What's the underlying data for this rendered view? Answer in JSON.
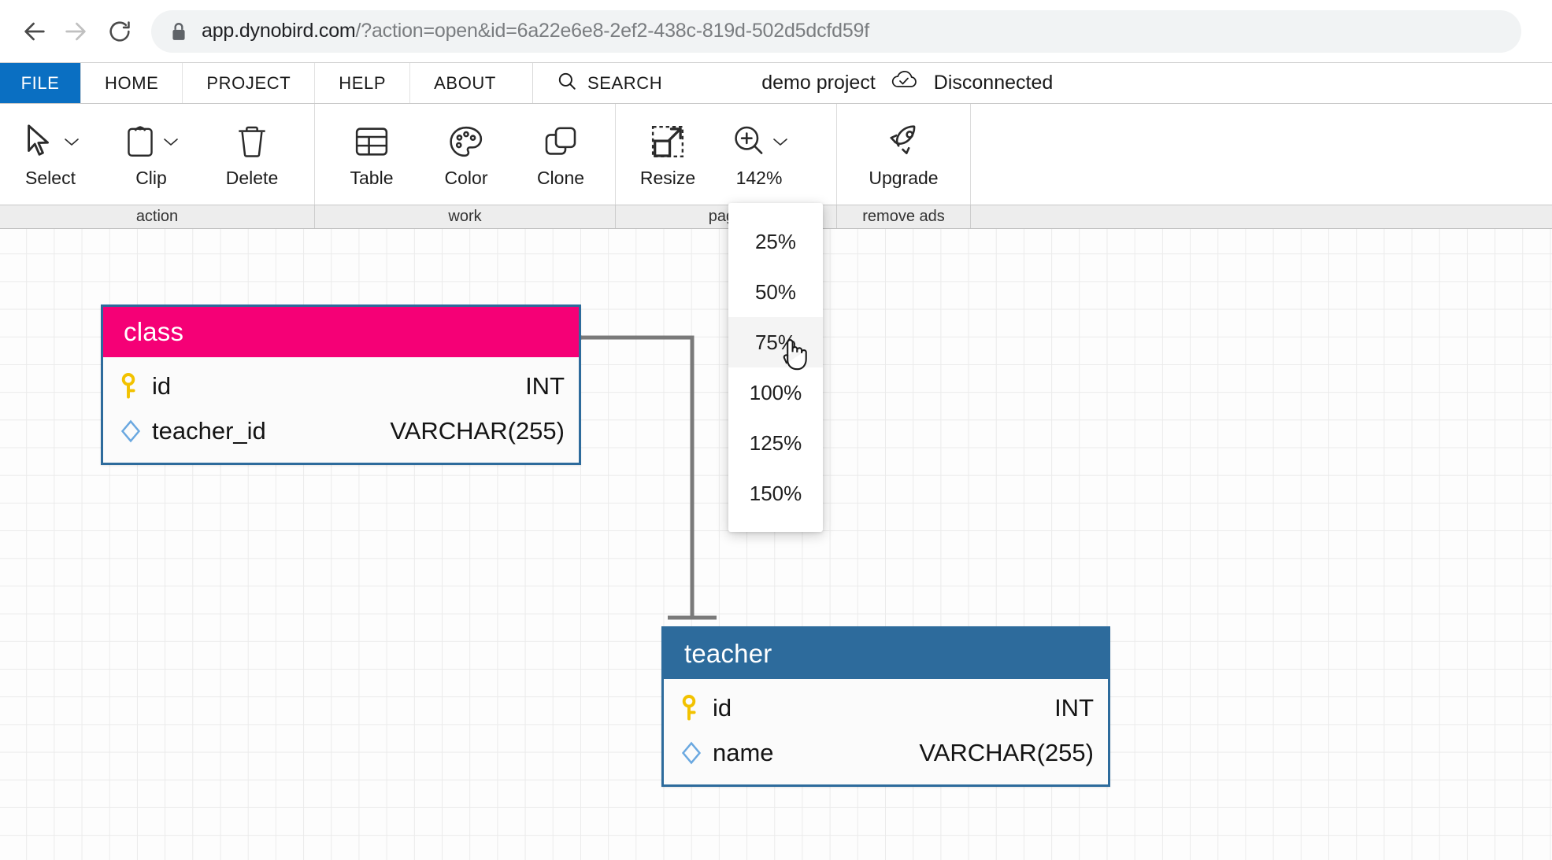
{
  "browser": {
    "back_icon": "arrow-left-icon",
    "forward_icon": "arrow-right-icon",
    "reload_icon": "reload-icon",
    "lock_icon": "lock-icon",
    "url_host": "app.dynobird.com",
    "url_path": "/?action=open&id=6a22e6e8-2ef2-438c-819d-502d5dcfd59f"
  },
  "menubar": {
    "file": "FILE",
    "items": [
      {
        "label": "HOME"
      },
      {
        "label": "PROJECT"
      },
      {
        "label": "HELP"
      },
      {
        "label": "ABOUT"
      }
    ],
    "search_label": "SEARCH",
    "search_icon": "search-icon"
  },
  "status": {
    "project_name": "demo project",
    "cloud_icon": "cloud-check-icon",
    "connection": "Disconnected"
  },
  "ribbon": {
    "groups": [
      {
        "caption": "action",
        "buttons": [
          {
            "label": "Select",
            "icon": "cursor-arrow-icon",
            "has_chevron": true
          },
          {
            "label": "Clip",
            "icon": "clipboard-icon",
            "has_chevron": true
          },
          {
            "label": "Delete",
            "icon": "trash-icon",
            "has_chevron": false
          }
        ]
      },
      {
        "caption": "work",
        "buttons": [
          {
            "label": "Table",
            "icon": "table-icon",
            "has_chevron": false
          },
          {
            "label": "Color",
            "icon": "palette-icon",
            "has_chevron": false
          },
          {
            "label": "Clone",
            "icon": "clone-icon",
            "has_chevron": false
          }
        ]
      },
      {
        "caption": "page",
        "buttons": [
          {
            "label": "Resize",
            "icon": "resize-icon",
            "has_chevron": false
          },
          {
            "label": "142%",
            "icon": "zoom-in-icon",
            "has_chevron": true
          }
        ]
      },
      {
        "caption": "remove ads",
        "buttons": [
          {
            "label": "Upgrade",
            "icon": "rocket-icon",
            "has_chevron": false
          }
        ]
      }
    ]
  },
  "zoom_menu": {
    "options": [
      {
        "label": "25%",
        "hovered": false
      },
      {
        "label": "50%",
        "hovered": false
      },
      {
        "label": "75%",
        "hovered": true
      },
      {
        "label": "100%",
        "hovered": false
      },
      {
        "label": "125%",
        "hovered": false
      },
      {
        "label": "150%",
        "hovered": false
      }
    ]
  },
  "diagram": {
    "tables": [
      {
        "name": "class",
        "header_color": "#f50076",
        "border_color": "#2d6b9c",
        "columns": [
          {
            "icon": "primary-key-icon",
            "name": "id",
            "type": "INT"
          },
          {
            "icon": "diamond-column-icon",
            "name": "teacher_id",
            "type": "VARCHAR(255)"
          }
        ]
      },
      {
        "name": "teacher",
        "header_color": "#2d6b9c",
        "border_color": "#2d6b9c",
        "columns": [
          {
            "icon": "primary-key-icon",
            "name": "id",
            "type": "INT"
          },
          {
            "icon": "diamond-column-icon",
            "name": "name",
            "type": "VARCHAR(255)"
          }
        ]
      }
    ],
    "relationship": {
      "from_table": "class",
      "to_table": "teacher",
      "from_notation": "crows-foot-many",
      "to_notation": "single-bar-one",
      "line_color": "#7a7a7a"
    }
  },
  "cursor": {
    "icon": "pointing-hand-cursor"
  }
}
